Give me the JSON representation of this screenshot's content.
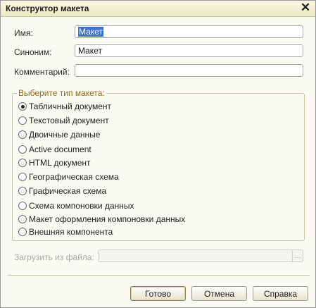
{
  "window": {
    "title": "Конструктор макета"
  },
  "fields": {
    "name_label": "Имя:",
    "name_value": "Макет",
    "synonym_label": "Синоним:",
    "synonym_value": "Макет",
    "comment_label": "Комментарий:",
    "comment_value": ""
  },
  "layout_type": {
    "legend": "Выберите тип макета:",
    "selected": "Табличный документ",
    "options": [
      "Табличный документ",
      "Текстовый документ",
      "Двоичные данные",
      "Active document",
      "HTML документ",
      "Географическая схема",
      "Графическая схема",
      "Схема компоновки данных",
      "Макет оформления компоновки данных",
      "Внешняя компонента"
    ]
  },
  "load_file": {
    "label": "Загрузить из файла:",
    "value": "",
    "browse": "..."
  },
  "buttons": {
    "ok": "Готово",
    "cancel": "Отмена",
    "help": "Справка"
  },
  "icons": {
    "close": "close-icon"
  }
}
